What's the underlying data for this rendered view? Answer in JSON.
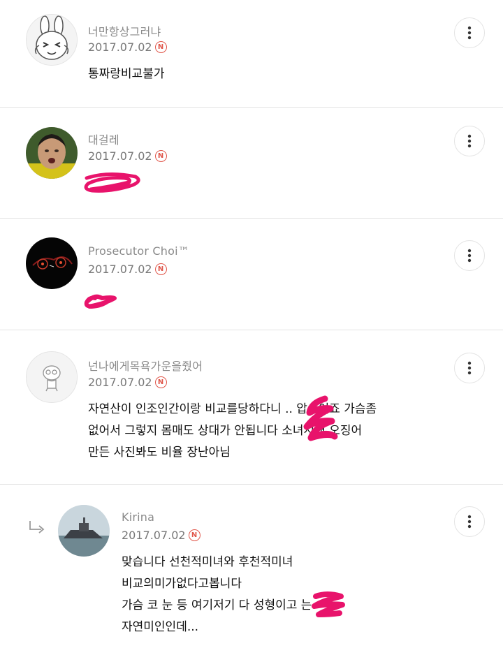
{
  "comments": [
    {
      "author": "너만항상그러냐",
      "date": "2017.07.02",
      "new_badge": "N",
      "lines": [
        "통짜랑비교불가"
      ],
      "avatar_icon": "rabbit-emoticon-avatar"
    },
    {
      "author": "대걸레",
      "date": "2017.07.02",
      "new_badge": "N",
      "lines": [],
      "avatar_icon": "face-photo-avatar"
    },
    {
      "author": "Prosecutor Choi™",
      "date": "2017.07.02",
      "new_badge": "N",
      "lines": [],
      "avatar_icon": "car-dashboard-avatar"
    },
    {
      "author": "넌나에게목욕가운을줬어",
      "date": "2017.07.02",
      "new_badge": "N",
      "lines": [
        "자연산이 인조인간이랑 비교를당하다니 ..      압승이죠 가슴좀",
        "없어서 그렇지 몸매도 상대가 안됩니다          소녀시대 오징어",
        "만든 사진봐도 비율 장난아님"
      ],
      "avatar_icon": "default-character-avatar"
    },
    {
      "author": "Kirina",
      "date": "2017.07.02",
      "new_badge": "N",
      "is_reply": true,
      "lines": [
        "맞습니다 선천적미녀와 후천적미녀",
        "비교의미가없다고봅니다",
        "가슴 코 눈 등 여기저기 다 성형이고          는",
        "자연미인인데..."
      ],
      "avatar_icon": "ship-photo-avatar"
    }
  ],
  "colors": {
    "new_badge": "#e0564a",
    "scribble": "#e8136b",
    "divider": "#e2e2e2"
  }
}
